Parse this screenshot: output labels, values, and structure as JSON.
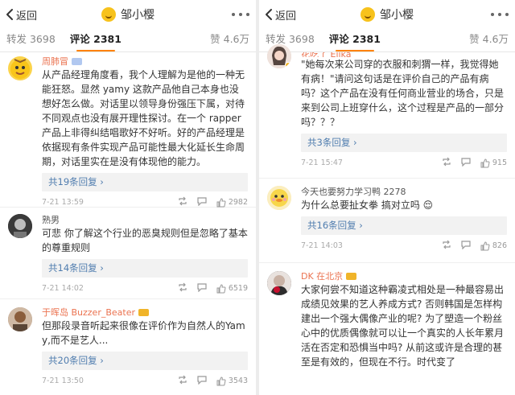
{
  "left": {
    "nav": {
      "back_label": "返回",
      "title": "邹小樱"
    },
    "tabs": {
      "repost": "转发 3698",
      "comments": "评论 2381",
      "likes": "赞 4.6万"
    },
    "comments": [
      {
        "name": "周肺冒",
        "badge_color": "#b1c8f0",
        "text": "从产品经理角度看，我个人理解为是他的一种无能狂怒。显然 yamy 这款产品他自己本身也没想好怎么做。对话里以领导身份强压下属，对待不同观点也没有展开理性探讨。在一个 rapper 产品上非得纠结唱歌好不好听。好的产品经理是依据现有条件实现产品可能性最大化延长生命周期，对话里实在是没有体现他的能力。",
        "replies": "共19条回复 ›",
        "time": "7-21 13:59",
        "likes": "2982",
        "avatar": "yellow-face"
      },
      {
        "name": "熟男",
        "text": "可悲 你了解这个行业的恶臭规则但是忽略了基本的尊重规则",
        "replies": "共14条回复 ›",
        "time": "7-21 14:02",
        "likes": "6519",
        "avatar": "dark-portrait"
      },
      {
        "name": "于晖岛 Buzzer_Beater",
        "badge_color": "#f0b429",
        "text": "但那段录音听起来很像在评价作为自然人的Yamy,而不是艺人...",
        "replies": "共20条回复 ›",
        "time": "7-21 13:50",
        "likes": "3543",
        "avatar": "photo-portrait"
      }
    ]
  },
  "right": {
    "nav": {
      "back_label": "返回",
      "title": "邹小樱"
    },
    "tabs": {
      "repost": "转发 3698",
      "comments": "评论 2381",
      "likes": "赞 4.6万"
    },
    "comments": [
      {
        "name": "花吃了 Elika",
        "text": "\"她每次来公司穿的衣服和刺猬一样，我觉得她有病！\"请问这句话是在评价自己的产品有病吗？这个产品在没有任何商业营业的场合，只是来到公司上班穿什么，这个过程是产品的一部分吗？？？",
        "replies": "共3条回复 ›",
        "time": "7-21 15:47",
        "likes": "915",
        "avatar": "girl-portrait"
      },
      {
        "name": "今天也要努力学习鸭 2278",
        "text": "为什么总要扯女拳 搞对立吗",
        "emoji": "😌",
        "replies": "共16条回复 ›",
        "time": "7-21 14:03",
        "likes": "826",
        "avatar": "duck-face"
      },
      {
        "name": "DK 在北京",
        "badge_color": "#f0b429",
        "text": "大家何尝不知道这种霸凌式相处是一种最容易出成绩见效果的艺人养成方式? 否则韩国是怎样构建出一个强大偶像产业的呢? 为了塑造一个粉丝心中的优质偶像就可以让一个真实的人长年累月活在否定和恐惧当中吗? 从前这或许是合理的甚至是有效的，但现在不行。时代变了",
        "time": "",
        "avatar": "red-portrait"
      }
    ]
  }
}
